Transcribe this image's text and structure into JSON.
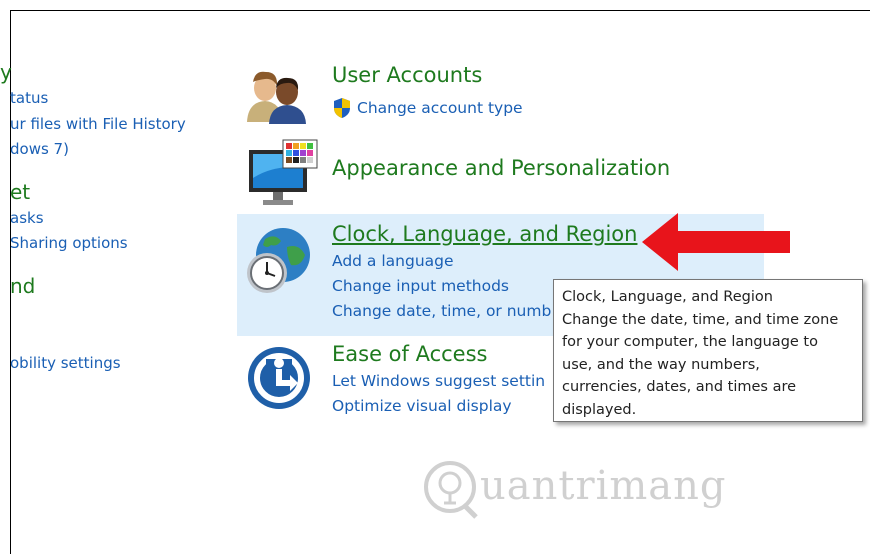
{
  "left_panel": {
    "items": [
      {
        "text": "y",
        "kind": "heading"
      },
      {
        "text": "tatus",
        "kind": "link"
      },
      {
        "text": "ur files with File History",
        "kind": "link"
      },
      {
        "text": "dows 7)",
        "kind": "link"
      },
      {
        "text": "et",
        "kind": "heading"
      },
      {
        "text": "asks",
        "kind": "link"
      },
      {
        "text": "Sharing options",
        "kind": "link"
      },
      {
        "text": "nd",
        "kind": "heading"
      },
      {
        "text": "obility settings",
        "kind": "link"
      }
    ]
  },
  "categories": {
    "user_accounts": {
      "title": "User Accounts",
      "icon": "users-icon",
      "links": [
        "Change account type"
      ]
    },
    "appearance": {
      "title": "Appearance and Personalization",
      "icon": "monitor-palette-icon"
    },
    "clock": {
      "title": "Clock, Language, and Region",
      "icon": "globe-clock-icon",
      "links": [
        "Add a language",
        "Change input methods",
        "Change date, time, or numb"
      ]
    },
    "ease": {
      "title": "Ease of Access",
      "icon": "ease-of-access-icon",
      "links": [
        "Let Windows suggest settin",
        "Optimize visual display"
      ]
    }
  },
  "tooltip": {
    "text": "Clock, Language, and Region\nChange the date, time, and time zone\nfor your computer, the language to\nuse, and the way numbers,\ncurrencies, dates, and times are\ndisplayed."
  },
  "annotation": {
    "arrow_color": "#e8141b",
    "icon": "red-arrow-icon"
  },
  "watermark": {
    "text": "uantrimang"
  },
  "colors": {
    "heading_green": "#1e7a1e",
    "link_blue": "#1a5fb4",
    "hover_bg": "#ddeefb"
  }
}
